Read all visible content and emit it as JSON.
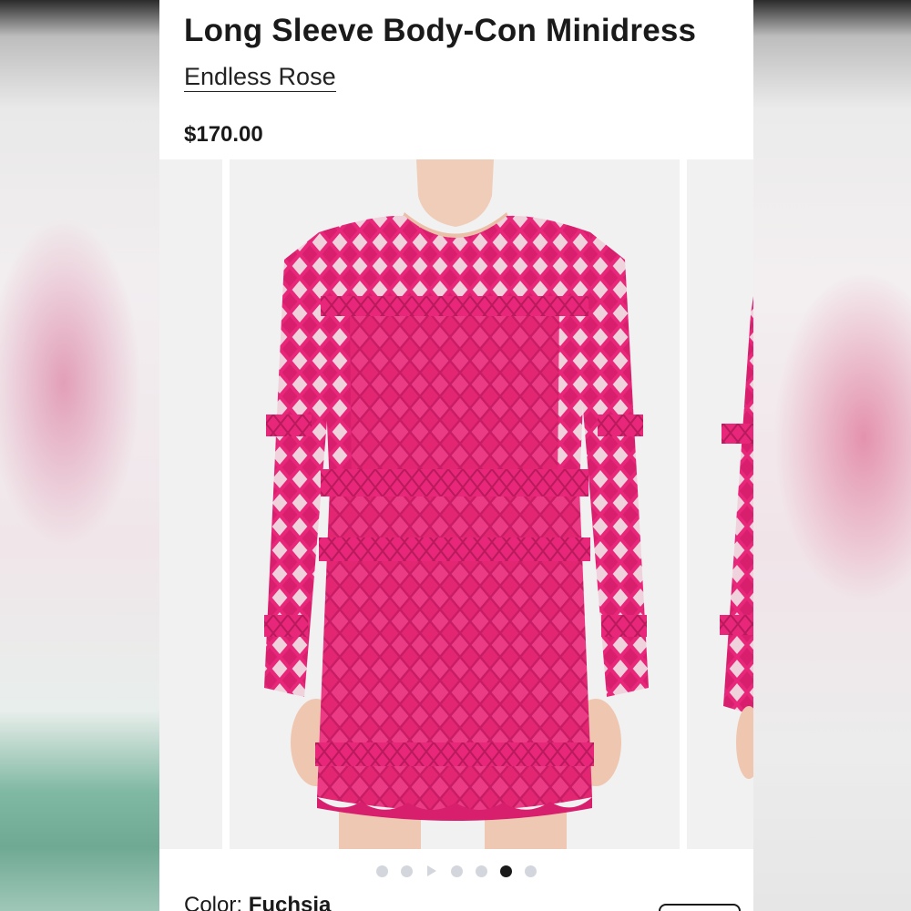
{
  "product": {
    "title": "Long Sleeve Body-Con Minidress",
    "brand": "Endless Rose",
    "price": "$170.00"
  },
  "gallery": {
    "image_alt": "Fuchsia crochet lace long sleeve minidress",
    "slide_count": 7,
    "active_index": 5,
    "video_slide_index": 2
  },
  "color": {
    "label": "Color: ",
    "value": "Fuchsia"
  },
  "colors": {
    "dress": "#e8277a",
    "dress_dark": "#c81d66",
    "skin": "#f0cdb8",
    "dot_inactive": "#d3d6dc",
    "dot_active": "#1a1a1a"
  }
}
